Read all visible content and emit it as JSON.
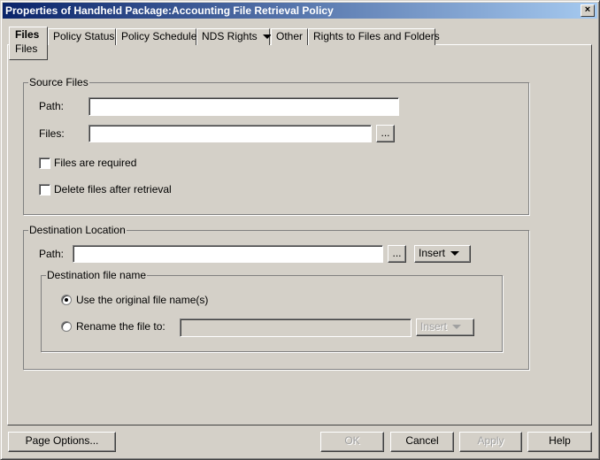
{
  "window": {
    "title": "Properties of Handheld Package:Accounting File Retrieval Policy",
    "close_label": "×"
  },
  "tabs": [
    {
      "label": "Files",
      "sublabel": "Files",
      "selected": true
    },
    {
      "label": "Policy Status"
    },
    {
      "label": "Policy Schedule"
    },
    {
      "label": "NDS Rights"
    },
    {
      "label": "Other"
    },
    {
      "label": "Rights to Files and Folders"
    }
  ],
  "source": {
    "legend": "Source Files",
    "path_label": "Path:",
    "path_value": "",
    "files_label": "Files:",
    "files_value": "",
    "browse_label": "...",
    "required_label": "Files are required",
    "required_checked": false,
    "delete_label": "Delete files after retrieval",
    "delete_checked": false
  },
  "destination": {
    "legend": "Destination Location",
    "path_label": "Path:",
    "path_value": "",
    "browse_label": "...",
    "insert_label": "Insert",
    "file_name": {
      "legend": "Destination file name",
      "option_original": "Use the original file name(s)",
      "option_rename": "Rename the file to:",
      "selected": "original",
      "rename_value": "",
      "insert_label": "Insert"
    }
  },
  "buttons": {
    "page_options": "Page Options...",
    "ok": "OK",
    "cancel": "Cancel",
    "apply": "Apply",
    "help": "Help"
  }
}
